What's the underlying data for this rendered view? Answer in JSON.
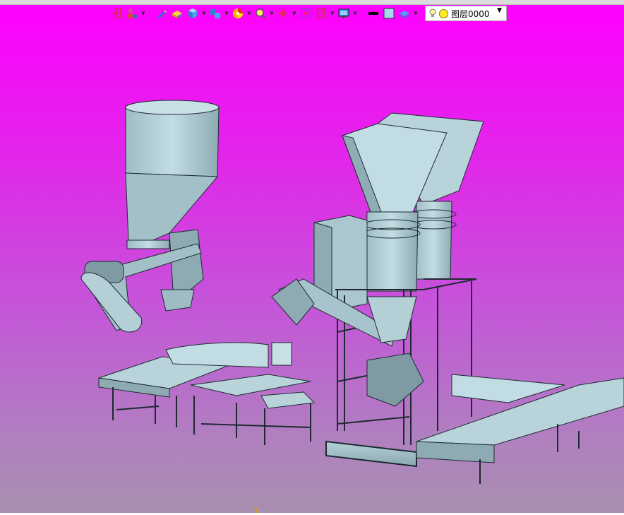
{
  "toolbar": {
    "icons": [
      "exit-icon",
      "person-gear-icon",
      "pencil-icon",
      "paint-box-icon",
      "cube-icon",
      "view-box-icon",
      "color-wheel-icon",
      "zoom-fit-icon",
      "crosshair-icon",
      "frame-select-icon",
      "section-icon",
      "monitor-icon",
      "line-style-icon",
      "fill-color-icon",
      "layer-stack-icon"
    ],
    "layer_selector": {
      "value": "图层0000"
    }
  },
  "colors": {
    "viewport_top": "#ff00ff",
    "viewport_bottom": "#a890b0",
    "model": "#a9c4cc",
    "model_dark": "#5f7c86",
    "edge": "#1d2a30"
  },
  "axis_indicator": "Y"
}
